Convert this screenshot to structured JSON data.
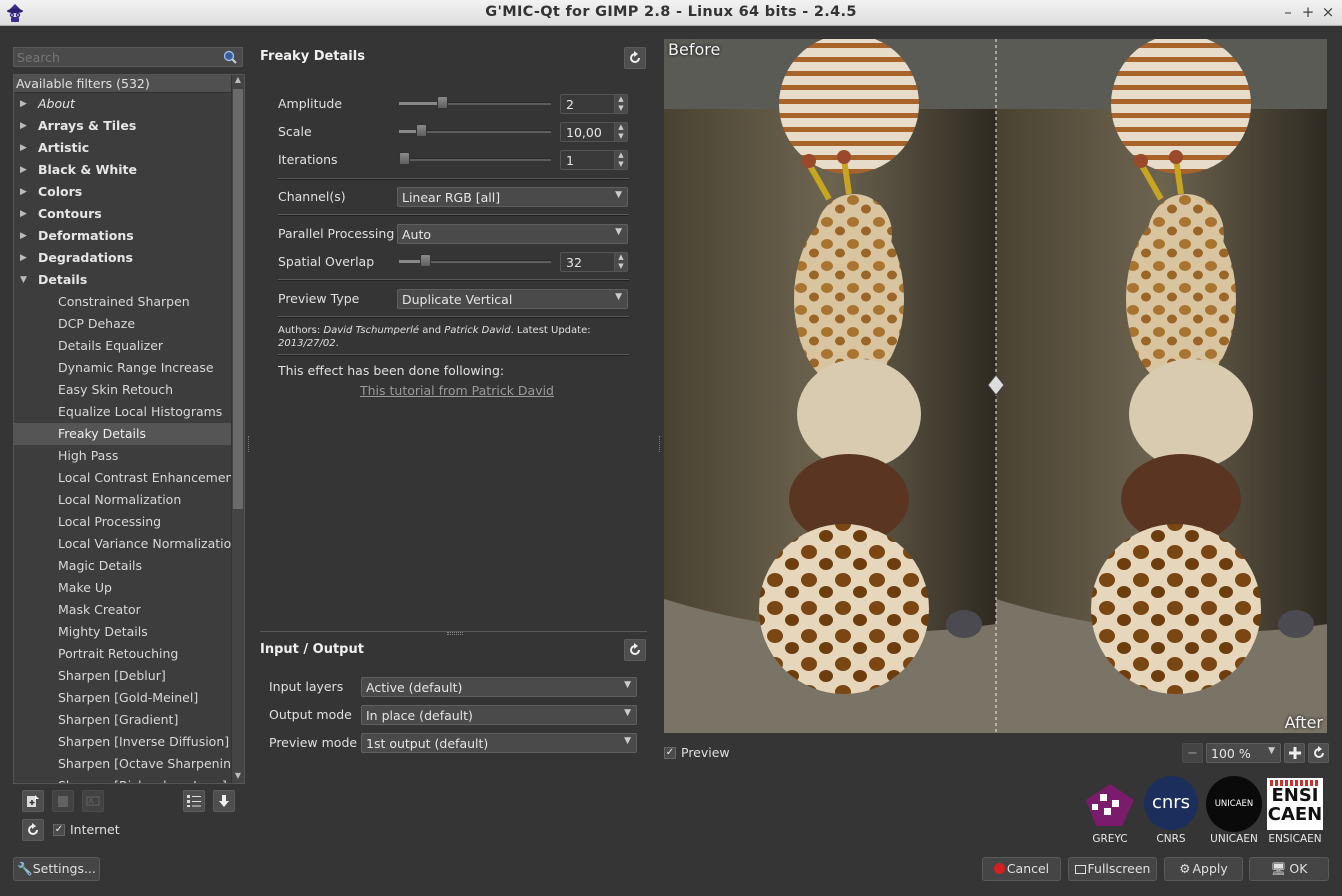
{
  "window": {
    "title": "G'MIC-Qt for GIMP 2.8 - Linux 64 bits - 2.4.5",
    "controls": [
      "–",
      "+",
      "×"
    ]
  },
  "search": {
    "placeholder": "Search"
  },
  "filters": {
    "header": "Available filters (532)",
    "categories": [
      {
        "label": "About",
        "italic": true
      },
      {
        "label": "Arrays & Tiles"
      },
      {
        "label": "Artistic"
      },
      {
        "label": "Black & White"
      },
      {
        "label": "Colors"
      },
      {
        "label": "Contours"
      },
      {
        "label": "Deformations"
      },
      {
        "label": "Degradations"
      },
      {
        "label": "Details",
        "expanded": true
      }
    ],
    "details_items": [
      "Constrained Sharpen",
      "DCP Dehaze",
      "Details Equalizer",
      "Dynamic Range Increase",
      "Easy Skin Retouch",
      "Equalize Local Histograms",
      "Freaky Details",
      "High Pass",
      "Local Contrast Enhancement",
      "Local Normalization",
      "Local Processing",
      "Local Variance Normalization",
      "Magic Details",
      "Make Up",
      "Mask Creator",
      "Mighty Details",
      "Portrait Retouching",
      "Sharpen [Deblur]",
      "Sharpen [Gold-Meinel]",
      "Sharpen [Gradient]",
      "Sharpen [Inverse Diffusion]",
      "Sharpen [Octave Sharpening]",
      "Sharpen [Richardson-Lucy]"
    ],
    "selected": "Freaky Details"
  },
  "bottom_left": {
    "internet_label": "Internet",
    "internet_checked": true,
    "settings_label": "Settings..."
  },
  "filter_panel": {
    "title": "Freaky Details",
    "params": {
      "amplitude": {
        "label": "Amplitude",
        "value": "2",
        "fraction": 0.27
      },
      "scale": {
        "label": "Scale",
        "value": "10,00",
        "fraction": 0.12
      },
      "iterations": {
        "label": "Iterations",
        "value": "1",
        "fraction": 0.0
      },
      "channels": {
        "label": "Channel(s)",
        "value": "Linear RGB [all]"
      },
      "parallel": {
        "label": "Parallel Processing",
        "value": "Auto"
      },
      "overlap": {
        "label": "Spatial Overlap",
        "value": "32",
        "fraction": 0.15
      },
      "preview_type": {
        "label": "Preview Type",
        "value": "Duplicate Vertical"
      }
    },
    "authors_prefix": "Authors: ",
    "author1": "David Tschumperlé",
    "authors_and": " and ",
    "author2": "Patrick David",
    "authors_update": ". Latest Update: ",
    "authors_date": "2013/27/02",
    "authors_end": ".",
    "effect_note": "This effect has been done following:",
    "tutorial_link": "This tutorial from Patrick David"
  },
  "io_panel": {
    "title": "Input / Output",
    "input_layers": {
      "label": "Input layers",
      "value": "Active (default)"
    },
    "output_mode": {
      "label": "Output mode",
      "value": "In place (default)"
    },
    "preview_mode": {
      "label": "Preview mode",
      "value": "1st output (default)"
    }
  },
  "preview": {
    "before_label": "Before",
    "after_label": "After",
    "preview_label": "Preview",
    "preview_checked": true,
    "zoom": "100 %"
  },
  "logos": [
    {
      "name": "greyc",
      "caption": "GREYC"
    },
    {
      "name": "cnrs",
      "caption": "CNRS",
      "text": "cnrs"
    },
    {
      "name": "unicaen",
      "caption": "UNICAEN",
      "text": "UNICAEN"
    },
    {
      "name": "ensicaen",
      "caption": "ENSICAEN",
      "text1": "ENSI",
      "text2": "CAEN"
    }
  ],
  "actions": {
    "cancel": "Cancel",
    "fullscreen": "Fullscreen",
    "apply": "Apply",
    "ok": "OK"
  },
  "colors": {
    "background": "#353535",
    "cancel_dot": "#d42020",
    "greyc": "#7a1b6b",
    "cnrs": "#1c2f5c"
  }
}
